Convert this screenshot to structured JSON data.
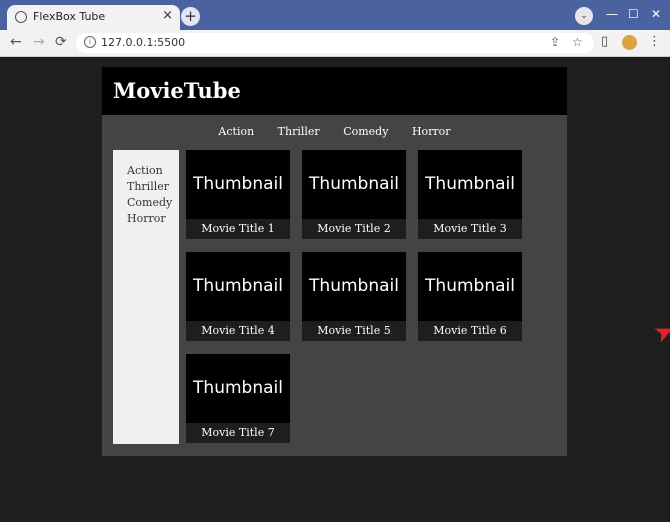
{
  "browser": {
    "tab_title": "FlexBox Tube",
    "tab_close": "×",
    "new_tab": "+",
    "url": "127.0.0.1:5500",
    "back": "←",
    "forward": "→",
    "reload": "⟳",
    "share": "⇪",
    "bookmark": "☆",
    "dropdown": "⌄",
    "minimize": "—",
    "maximize": "☐",
    "close": "✕",
    "menu": "⋮",
    "side_panel": "▯",
    "site_info": "i"
  },
  "site": {
    "logo": "MovieTube",
    "nav": [
      "Action",
      "Thriller",
      "Comedy",
      "Horror"
    ],
    "sidebar": [
      "Action",
      "Thriller",
      "Comedy",
      "Horror"
    ],
    "movies": [
      {
        "thumb": "Thumbnail",
        "title": "Movie Title 1"
      },
      {
        "thumb": "Thumbnail",
        "title": "Movie Title 2"
      },
      {
        "thumb": "Thumbnail",
        "title": "Movie Title 3"
      },
      {
        "thumb": "Thumbnail",
        "title": "Movie Title 4"
      },
      {
        "thumb": "Thumbnail",
        "title": "Movie Title 5"
      },
      {
        "thumb": "Thumbnail",
        "title": "Movie Title 6"
      },
      {
        "thumb": "Thumbnail",
        "title": "Movie Title 7"
      }
    ]
  },
  "colors": {
    "titlebar": "#4a62a0",
    "page_bg": "#1e1e1e",
    "site_bg": "#444444",
    "header_bg": "#000000",
    "sidebar_bg": "#f0f0f0"
  },
  "icons": [
    "globe-icon",
    "close-icon",
    "plus-icon",
    "back-arrow-icon",
    "forward-arrow-icon",
    "reload-icon",
    "info-icon",
    "share-icon",
    "star-icon",
    "side-panel-icon",
    "avatar-icon",
    "kebab-menu-icon",
    "cursor-icon"
  ]
}
